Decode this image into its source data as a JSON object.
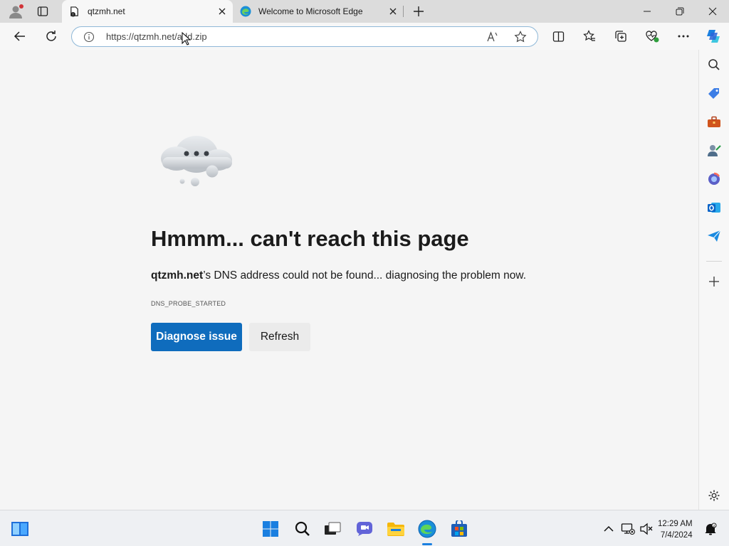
{
  "tabs": [
    {
      "title": "qtzmh.net",
      "active": true
    },
    {
      "title": "Welcome to Microsoft Edge",
      "active": false
    }
  ],
  "address_bar": {
    "url": "https://qtzmh.net/add.zip"
  },
  "error_page": {
    "heading": "Hmmm... can't reach this page",
    "domain": "qtzmh.net",
    "message": "’s DNS address could not be found... diagnosing the problem now.",
    "error_code": "DNS_PROBE_STARTED",
    "primary_button": "Diagnose issue",
    "secondary_button": "Refresh"
  },
  "sidebar_icons": [
    "search-icon",
    "shopping-tag-icon",
    "tools-icon",
    "games-icon",
    "microsoft365-icon",
    "outlook-icon",
    "send-icon",
    "add-icon",
    "settings-icon"
  ],
  "taskbar": {
    "time": "12:29 AM",
    "date": "7/4/2024"
  },
  "colors": {
    "accent": "#0f6cbd",
    "omnibox_border": "#8fb8d8"
  }
}
